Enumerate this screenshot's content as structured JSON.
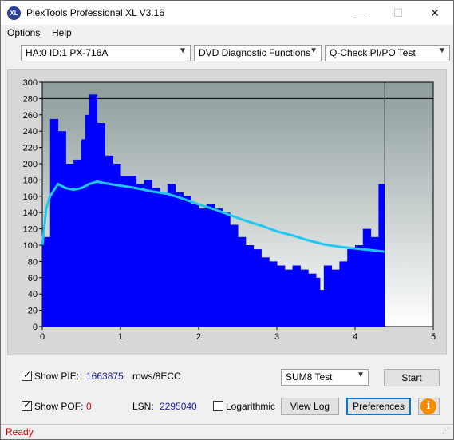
{
  "window": {
    "title": "PlexTools Professional XL V3.16",
    "icon_text": "XL",
    "minimize_icon": "minimize-icon",
    "maximize_icon": "maximize-icon",
    "close_icon": "close-icon"
  },
  "menu": {
    "options": "Options",
    "help": "Help"
  },
  "toolbar": {
    "drive": "HA:0 ID:1  PX-716A",
    "function": "DVD Diagnostic Functions",
    "test": "Q-Check PI/PO Test"
  },
  "chart_data": {
    "type": "bar",
    "title": "",
    "xlabel": "",
    "ylabel": "",
    "xlim": [
      0,
      5
    ],
    "ylim": [
      0,
      300
    ],
    "x_ticks": [
      "0",
      "1",
      "2",
      "3",
      "4",
      "5"
    ],
    "y_ticks": [
      "0",
      "20",
      "40",
      "60",
      "80",
      "100",
      "120",
      "140",
      "160",
      "180",
      "200",
      "220",
      "240",
      "260",
      "280",
      "300"
    ],
    "threshold_line": 280,
    "end_x": 4.38,
    "bar_color": "#0000ff",
    "average_color": "#1ec8f0",
    "series": [
      {
        "type": "bar",
        "x": [
          0.0,
          0.1,
          0.2,
          0.3,
          0.4,
          0.5,
          0.55,
          0.6,
          0.7,
          0.8,
          0.9,
          1.0,
          1.1,
          1.2,
          1.3,
          1.4,
          1.5,
          1.6,
          1.7,
          1.8,
          1.9,
          2.0,
          2.1,
          2.2,
          2.3,
          2.4,
          2.5,
          2.6,
          2.7,
          2.8,
          2.9,
          3.0,
          3.1,
          3.2,
          3.3,
          3.4,
          3.5,
          3.55,
          3.6,
          3.7,
          3.8,
          3.9,
          4.0,
          4.1,
          4.2,
          4.3,
          4.38
        ],
        "values": [
          110,
          255,
          240,
          200,
          205,
          230,
          260,
          285,
          250,
          210,
          200,
          185,
          185,
          175,
          180,
          170,
          165,
          175,
          165,
          160,
          150,
          145,
          150,
          145,
          140,
          125,
          110,
          100,
          95,
          85,
          80,
          75,
          70,
          75,
          70,
          65,
          60,
          45,
          75,
          70,
          80,
          95,
          100,
          120,
          110,
          175,
          110
        ]
      },
      {
        "type": "line",
        "x": [
          0.0,
          0.05,
          0.1,
          0.2,
          0.3,
          0.4,
          0.5,
          0.6,
          0.7,
          0.8,
          1.0,
          1.2,
          1.4,
          1.6,
          1.8,
          2.0,
          2.2,
          2.4,
          2.6,
          2.8,
          3.0,
          3.2,
          3.4,
          3.6,
          3.8,
          4.0,
          4.2,
          4.38
        ],
        "values": [
          100,
          145,
          160,
          175,
          170,
          168,
          170,
          175,
          178,
          176,
          173,
          170,
          166,
          163,
          157,
          150,
          144,
          137,
          130,
          124,
          117,
          112,
          106,
          101,
          98,
          96,
          94,
          92
        ]
      }
    ]
  },
  "bottom": {
    "show_pie_label": "Show PIE:",
    "pie_value": "1663875",
    "pie_unit": "rows/8ECC",
    "show_pof_label": "Show POF:",
    "pof_value": "0",
    "lsn_label": "LSN:",
    "lsn_value": "2295040",
    "logarithmic_label": "Logarithmic",
    "test_select": "SUM8 Test",
    "start_button": "Start",
    "view_log_button": "View Log",
    "preferences_button": "Preferences",
    "info_icon": "info-icon"
  },
  "status": {
    "text": "Ready"
  }
}
